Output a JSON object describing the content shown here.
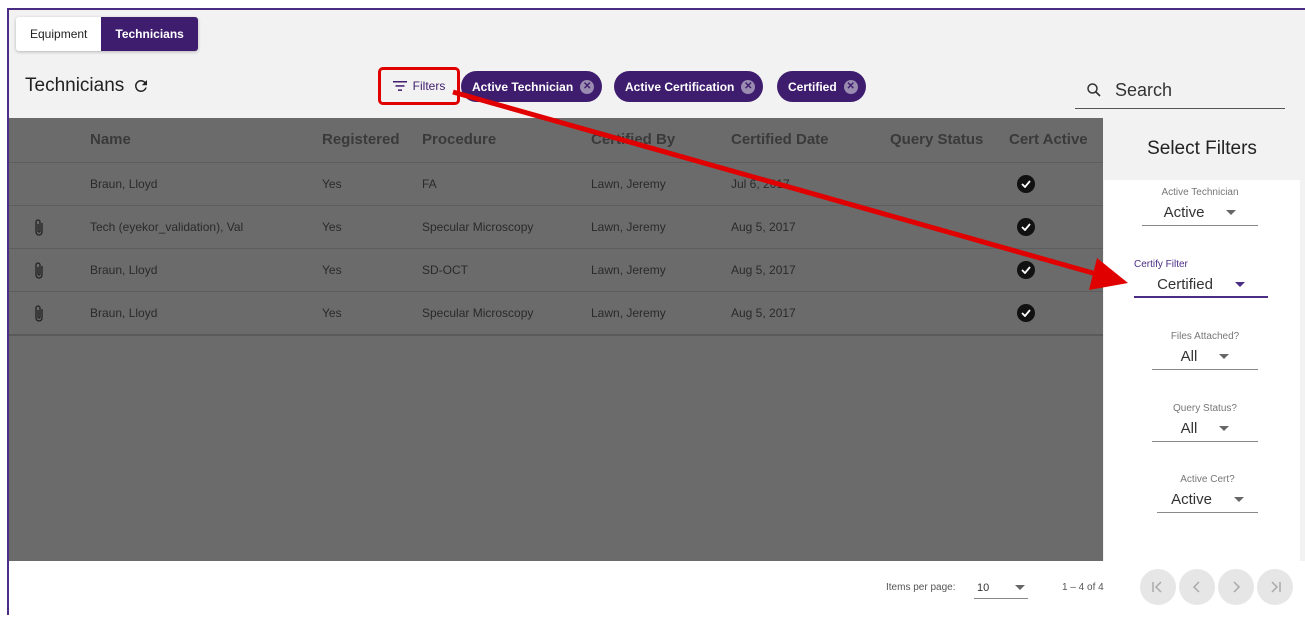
{
  "tabs": [
    {
      "label": "Equipment",
      "active": false
    },
    {
      "label": "Technicians",
      "active": true
    }
  ],
  "toolbar": {
    "title": "Technicians",
    "filters_label": "Filters",
    "chips": [
      "Active Technician",
      "Active Certification",
      "Certified"
    ],
    "search_placeholder": "Search"
  },
  "table": {
    "columns": [
      "Name",
      "Registered",
      "Procedure",
      "Certified By",
      "Certified Date",
      "Query Status",
      "Cert Active"
    ],
    "rows": [
      {
        "attachment": false,
        "name": "Braun, Lloyd",
        "registered": "Yes",
        "procedure": "FA",
        "certified_by": "Lawn, Jeremy",
        "certified_date": "Jul 6, 2017",
        "query_status": "",
        "cert_active": true
      },
      {
        "attachment": true,
        "name": "Tech (eyekor_validation), Val",
        "registered": "Yes",
        "procedure": "Specular Microscopy",
        "certified_by": "Lawn, Jeremy",
        "certified_date": "Aug 5, 2017",
        "query_status": "",
        "cert_active": true
      },
      {
        "attachment": true,
        "name": "Braun, Lloyd",
        "registered": "Yes",
        "procedure": "SD-OCT",
        "certified_by": "Lawn, Jeremy",
        "certified_date": "Aug 5, 2017",
        "query_status": "",
        "cert_active": true
      },
      {
        "attachment": true,
        "name": "Braun, Lloyd",
        "registered": "Yes",
        "procedure": "Specular Microscopy",
        "certified_by": "Lawn, Jeremy",
        "certified_date": "Aug 5, 2017",
        "query_status": "",
        "cert_active": true
      }
    ]
  },
  "filter_panel": {
    "title": "Select Filters",
    "fields": [
      {
        "label": "Active Technician",
        "value": "Active"
      },
      {
        "label": "Certify Filter",
        "value": "Certified"
      },
      {
        "label": "Files Attached?",
        "value": "All"
      },
      {
        "label": "Query Status?",
        "value": "All"
      },
      {
        "label": "Active Cert?",
        "value": "Active"
      }
    ]
  },
  "paginator": {
    "items_per_page_label": "Items per page:",
    "items_per_page": "10",
    "range_label": "1 – 4 of 4"
  },
  "colors": {
    "brand": "#3f1d6e",
    "annotation": "#e00000",
    "overlay": "#6b6b6b"
  }
}
